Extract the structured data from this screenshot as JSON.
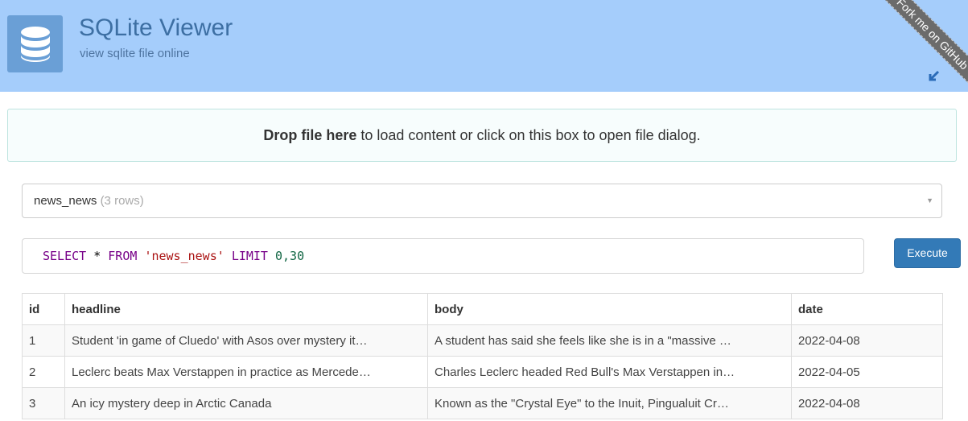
{
  "header": {
    "title": "SQLite Viewer",
    "subtitle": "view sqlite file online",
    "ribbon_text": "Fork me on GitHub",
    "brand_color": "#a5cdfb",
    "logo_icon": "database-icon"
  },
  "dropzone": {
    "strong_text": "Drop file here",
    "rest_text": " to load content or click on this box to open file dialog."
  },
  "table_select": {
    "table_name": "news_news",
    "row_count": "(3 rows)"
  },
  "query": {
    "select_kw": "SELECT",
    "star": "*",
    "from_kw": "FROM",
    "table_str": "'news_news'",
    "limit_kw": "LIMIT",
    "limit_val": "0,30"
  },
  "execute_label": "Execute",
  "results": {
    "columns": [
      "id",
      "headline",
      "body",
      "date"
    ],
    "rows": [
      [
        "1",
        "Student 'in game of Cluedo' with Asos over mystery it…",
        "A student has said she feels like she is in a \"massive …",
        "2022-04-08"
      ],
      [
        "2",
        "Leclerc beats Max Verstappen in practice as Mercede…",
        "Charles Leclerc headed Red Bull's Max Verstappen in…",
        "2022-04-05"
      ],
      [
        "3",
        "An icy mystery deep in Arctic Canada",
        "Known as the \"Crystal Eye\" to the Inuit, Pingualuit Cr…",
        "2022-04-08"
      ]
    ]
  }
}
